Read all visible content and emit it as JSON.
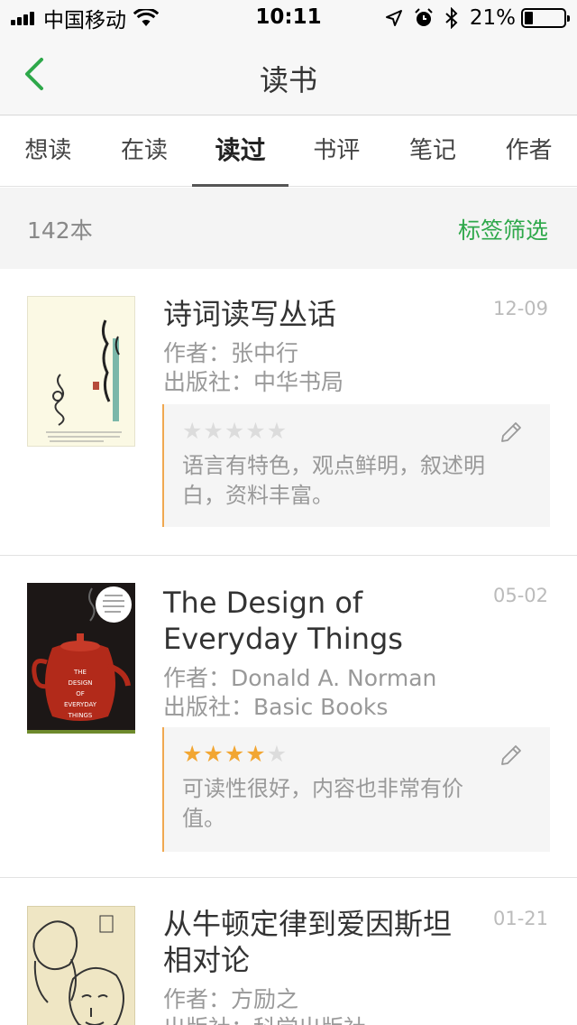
{
  "status_bar": {
    "carrier": "中国移动",
    "time": "10:11",
    "battery": "21%"
  },
  "nav": {
    "title": "读书"
  },
  "tabs": [
    {
      "label": "想读",
      "active": false
    },
    {
      "label": "在读",
      "active": false
    },
    {
      "label": "读过",
      "active": true
    },
    {
      "label": "书评",
      "active": false
    },
    {
      "label": "笔记",
      "active": false
    },
    {
      "label": "作者",
      "active": false
    }
  ],
  "summary": {
    "count": "142本",
    "filter": "标签筛选"
  },
  "books": [
    {
      "title": "诗词读写丛话",
      "date": "12-09",
      "author": "作者：张中行",
      "publisher": "出版社：中华书局",
      "rating": 0,
      "review": "语言有特色，观点鲜明，叙述明白，资料丰富。"
    },
    {
      "title": "The Design of Everyday Things",
      "date": "05-02",
      "author": "作者：Donald A. Norman",
      "publisher": "出版社：Basic Books",
      "rating": 4,
      "review": "可读性很好，内容也非常有价值。"
    },
    {
      "title": "从牛顿定律到爱因斯坦相对论",
      "date": "01-21",
      "author": "作者：方励之",
      "publisher": "出版社：科学出版社"
    }
  ],
  "colors": {
    "accent": "#2ea84a",
    "star": "#f2a632",
    "review_border": "#f0a850"
  }
}
